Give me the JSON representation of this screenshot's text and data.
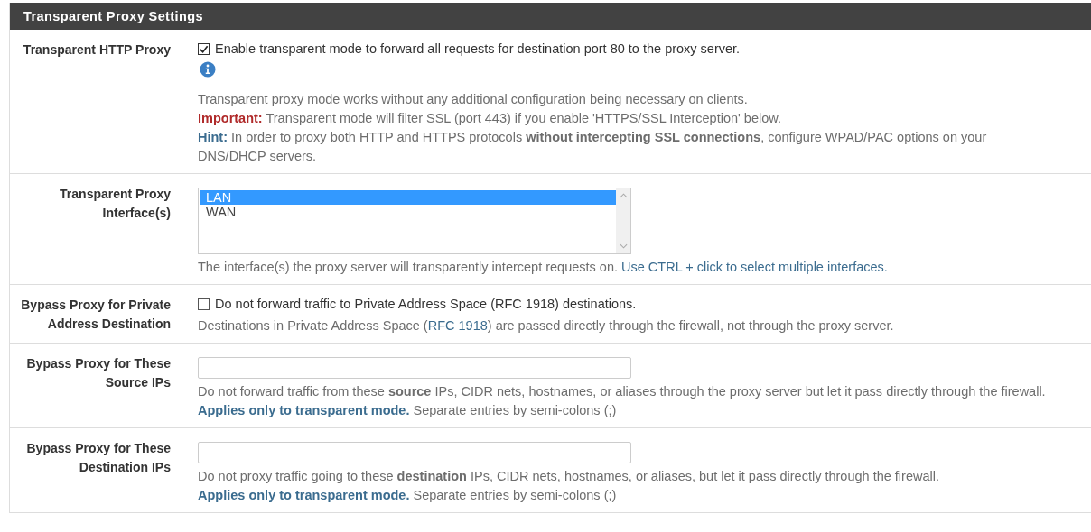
{
  "panel": {
    "title": "Transparent Proxy Settings"
  },
  "rows": [
    {
      "label": "Transparent HTTP Proxy",
      "kind": "checkbox",
      "checked": true,
      "option_text": "Enable transparent mode to forward all requests for destination port 80 to the proxy server.",
      "info_icon": true,
      "help": [
        [
          {
            "kind": "text",
            "text": "Transparent proxy mode works without any additional configuration being necessary on clients."
          }
        ],
        [
          {
            "kind": "important",
            "text": "Important:"
          },
          {
            "kind": "text",
            "text": " Transparent mode will filter SSL (port 443) if you enable 'HTTPS/SSL Interception' below."
          }
        ],
        [
          {
            "kind": "hint",
            "text": "Hint:"
          },
          {
            "kind": "text",
            "text": " In order to proxy both HTTP and HTTPS protocols **without intercepting SSL connections**, configure WPAD/PAC options on your DNS/DHCP servers."
          }
        ]
      ]
    },
    {
      "label": "Transparent Proxy Interface(s)",
      "kind": "listbox",
      "options": [
        {
          "text": "LAN",
          "selected": true
        },
        {
          "text": "WAN",
          "selected": false
        }
      ],
      "help": [
        [
          {
            "kind": "text",
            "text": "The interface(s) the proxy server will transparently intercept requests on. "
          },
          {
            "kind": "link",
            "text": "Use CTRL + click to select multiple interfaces."
          }
        ]
      ]
    },
    {
      "label": "Bypass Proxy for Private Address Destination",
      "kind": "checkbox",
      "checked": false,
      "option_text": "Do not forward traffic to Private Address Space (RFC 1918) destinations.",
      "info_icon": false,
      "help": [
        [
          {
            "kind": "text",
            "text": "Destinations in Private Address Space ("
          },
          {
            "kind": "link",
            "text": "RFC 1918"
          },
          {
            "kind": "text",
            "text": ") are passed directly through the firewall, not through the proxy server."
          }
        ]
      ]
    },
    {
      "label": "Bypass Proxy for These Source IPs",
      "kind": "input",
      "help": [
        [
          {
            "kind": "text",
            "text": "Do not forward traffic from these **source** IPs, CIDR nets, hostnames, or aliases through the proxy server but let it pass directly through the firewall."
          }
        ],
        [
          {
            "kind": "hint",
            "text": "Applies only to transparent mode."
          },
          {
            "kind": "text",
            "text": " Separate entries by semi-colons (;)"
          }
        ]
      ]
    },
    {
      "label": "Bypass Proxy for These Destination IPs",
      "kind": "input",
      "help": [
        [
          {
            "kind": "text",
            "text": "Do not proxy traffic going to these **destination** IPs, CIDR nets, hostnames, or aliases, but let it pass directly through the firewall."
          }
        ],
        [
          {
            "kind": "hint",
            "text": "Applies only to transparent mode."
          },
          {
            "kind": "text",
            "text": " Separate entries by semi-colons (;)"
          }
        ]
      ]
    }
  ]
}
